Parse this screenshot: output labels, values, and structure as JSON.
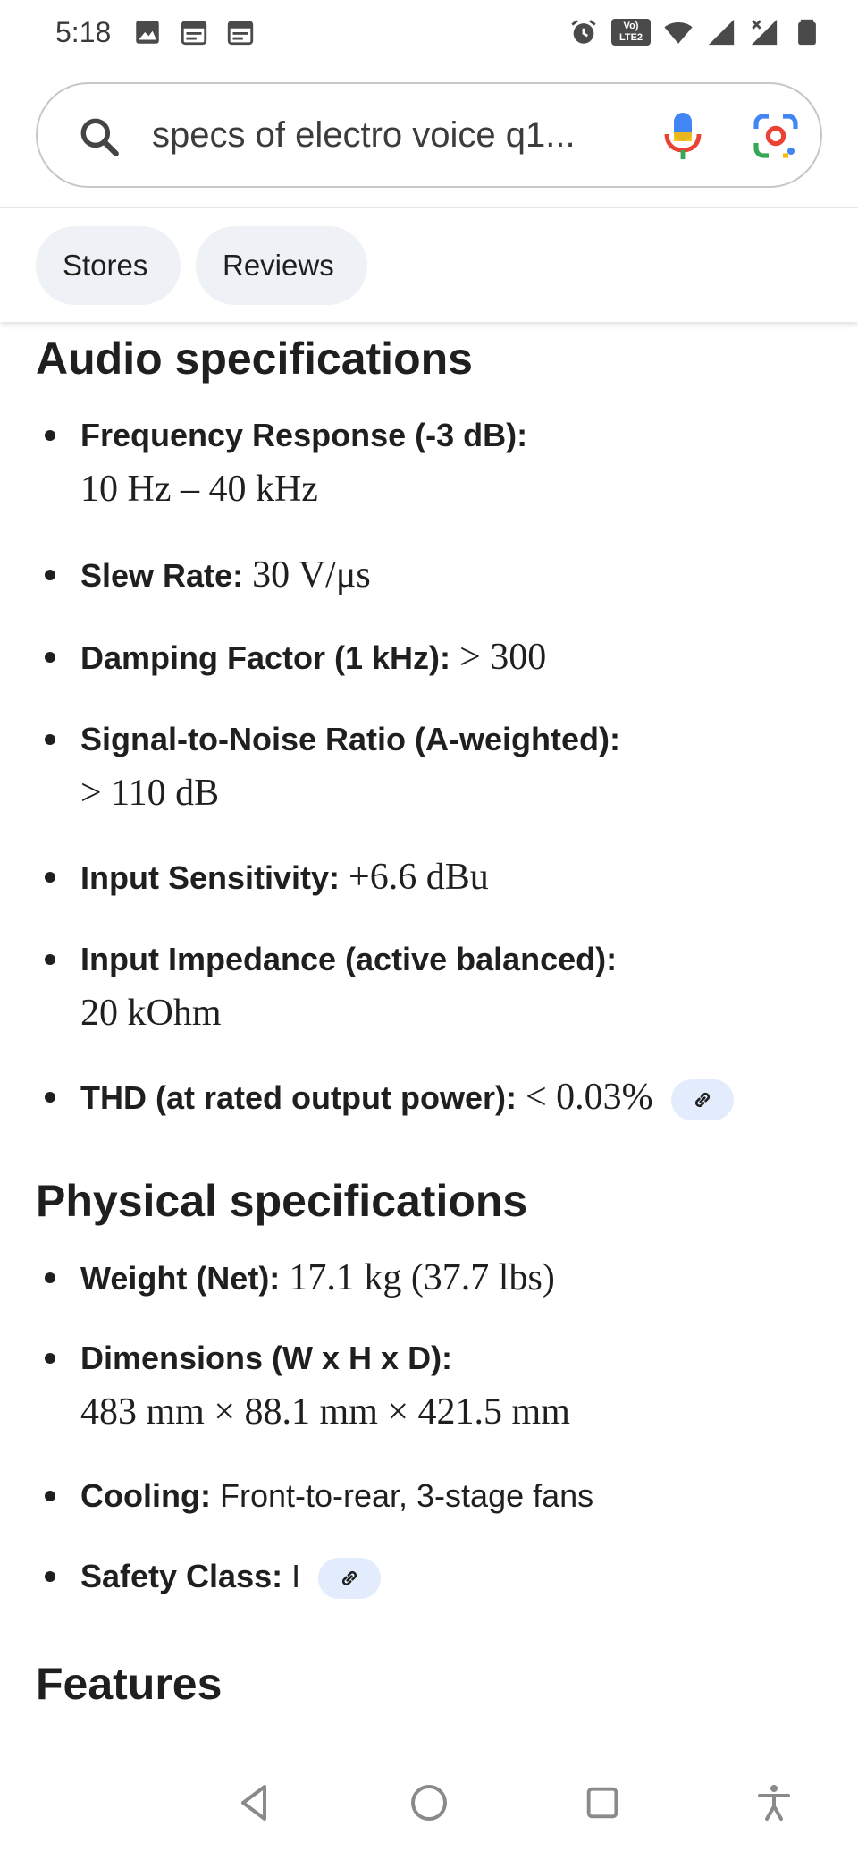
{
  "status_bar": {
    "time": "5:18",
    "left_icons": [
      "image-icon",
      "calendar-icon",
      "calendar-icon"
    ],
    "right_icons": [
      "alarm-icon",
      "volte-icon",
      "wifi-icon",
      "signal-icon",
      "signal-icon",
      "battery-icon"
    ],
    "volte_label_top": "Vo)",
    "volte_label_bottom": "LTE2"
  },
  "search": {
    "query": "specs of electro voice q1...",
    "icons": [
      "search-icon",
      "mic-icon",
      "google-lens-icon"
    ]
  },
  "chips": [
    "Stores",
    "Reviews"
  ],
  "sections": {
    "audio": {
      "title": "Audio specifications",
      "items": [
        {
          "label": "Frequency Response (-3 dB):",
          "value": "10 Hz – 40 kHz"
        },
        {
          "label": "Slew Rate:",
          "value": "30 V/μs"
        },
        {
          "label": "Damping Factor (1 kHz):",
          "value": "> 300"
        },
        {
          "label": "Signal-to-Noise Ratio (A-weighted):",
          "value": "> 110 dB"
        },
        {
          "label": "Input Sensitivity:",
          "value": "+6.6 dBu"
        },
        {
          "label": "Input Impedance (active balanced):",
          "value": "20 kOhm"
        },
        {
          "label": "THD (at rated output power):",
          "value": "< 0.03%"
        }
      ]
    },
    "physical": {
      "title": "Physical specifications",
      "items": [
        {
          "label": "Weight (Net):",
          "value": "17.1 kg (37.7 lbs)"
        },
        {
          "label": "Dimensions (W x H x D):",
          "value": "483 mm × 88.1 mm × 421.5 mm"
        },
        {
          "label": "Cooling:",
          "value": "Front-to-rear, 3-stage fans"
        },
        {
          "label": "Safety Class:",
          "value": "I"
        }
      ]
    },
    "features": {
      "title": "Features"
    }
  },
  "nav_bar": [
    "back-icon",
    "home-icon",
    "recents-icon",
    "accessibility-icon"
  ],
  "colors": {
    "chip_bg": "#eef1f5",
    "link_chip_bg": "#e3ecfd",
    "google_blue": "#4285F4",
    "google_red": "#EA4335",
    "google_yellow": "#FBBC05",
    "google_green": "#34A853"
  }
}
